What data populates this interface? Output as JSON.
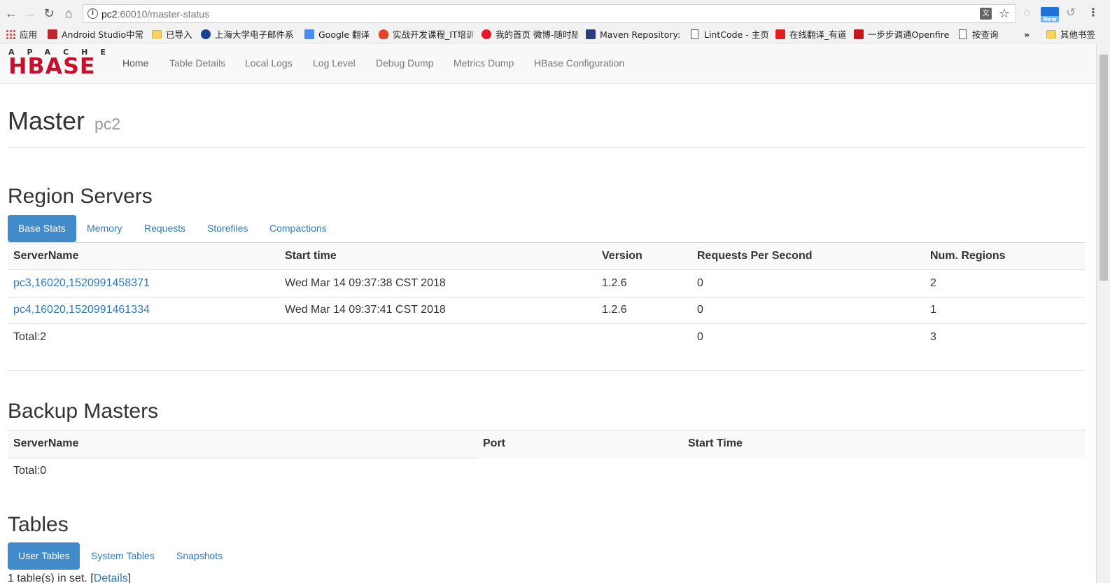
{
  "browser": {
    "url_host": "pc2",
    "url_path": ":60010/master-status",
    "bookmarks": [
      {
        "label": "应用",
        "icon": "apps-grid-icon"
      },
      {
        "label": "Android Studio中常",
        "icon": "shield-icon"
      },
      {
        "label": "已导入",
        "icon": "folder-icon"
      },
      {
        "label": "上海大学电子邮件系",
        "icon": "university-icon"
      },
      {
        "label": "Google 翻译",
        "icon": "google-translate-icon"
      },
      {
        "label": "实战开发课程_IT培训",
        "icon": "flame-icon"
      },
      {
        "label": "我的首页 微博-随时随",
        "icon": "weibo-icon"
      },
      {
        "label": "Maven Repository:",
        "icon": "maven-icon"
      },
      {
        "label": "LintCode - 主页",
        "icon": "page-icon"
      },
      {
        "label": "在线翻译_有道",
        "icon": "youdao-icon"
      },
      {
        "label": "一步步调通Openfire",
        "icon": "csdn-icon"
      },
      {
        "label": "按查询",
        "icon": "page-icon"
      },
      {
        "label": "其他书签",
        "icon": "folder-icon"
      }
    ],
    "new_badge": "New"
  },
  "navbar": {
    "logo_top": "APACHE",
    "logo_main": "HBASE",
    "links": [
      "Home",
      "Table Details",
      "Local Logs",
      "Log Level",
      "Debug Dump",
      "Metrics Dump",
      "HBase Configuration"
    ]
  },
  "header": {
    "title": "Master",
    "host": "pc2"
  },
  "region_servers": {
    "title": "Region Servers",
    "tabs": [
      "Base Stats",
      "Memory",
      "Requests",
      "Storefiles",
      "Compactions"
    ],
    "columns": [
      "ServerName",
      "Start time",
      "Version",
      "Requests Per Second",
      "Num. Regions"
    ],
    "rows": [
      {
        "server": "pc3,16020,1520991458371",
        "start": "Wed Mar 14 09:37:38 CST 2018",
        "version": "1.2.6",
        "rps": "0",
        "regions": "2"
      },
      {
        "server": "pc4,16020,1520991461334",
        "start": "Wed Mar 14 09:37:41 CST 2018",
        "version": "1.2.6",
        "rps": "0",
        "regions": "1"
      }
    ],
    "total": {
      "label": "Total:2",
      "rps": "0",
      "regions": "3"
    }
  },
  "backup_masters": {
    "title": "Backup Masters",
    "columns": [
      "ServerName",
      "Port",
      "Start Time"
    ],
    "total": "Total:0"
  },
  "tables": {
    "title": "Tables",
    "tabs": [
      "User Tables",
      "System Tables",
      "Snapshots"
    ],
    "summary": "1 table(s) in set.",
    "details_link": "Details"
  }
}
